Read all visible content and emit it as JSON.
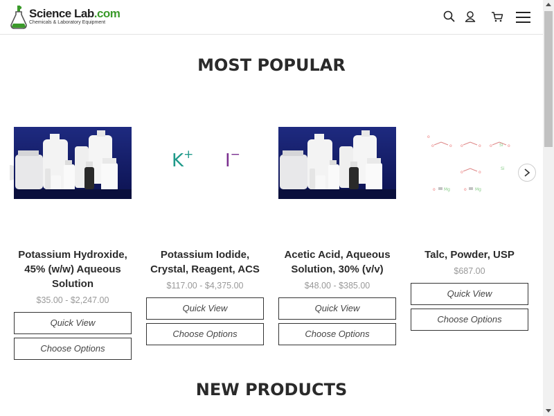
{
  "header": {
    "logo": {
      "main": "Science Lab",
      "dot": ".com",
      "sub": "Chemicals & Laboratory Equipment"
    },
    "icons": [
      "search-icon",
      "account-icon",
      "cart-icon",
      "menu-icon"
    ]
  },
  "sections": {
    "most_popular": "MOST POPULAR",
    "new_products": "NEW PRODUCTS"
  },
  "products": [
    {
      "name_lines": [
        "Potassium Hydroxide,",
        "45% (w/w) Aqueous",
        "Solution"
      ],
      "price": "$35.00 - $2,247.00",
      "quick_view": "Quick View",
      "choose_options": "Choose Options",
      "image": "bottles-photo"
    },
    {
      "name_lines": [
        "Potassium Iodide,",
        "Crystal, Reagent, ACS"
      ],
      "price": "$117.00 - $4,375.00",
      "quick_view": "Quick View",
      "choose_options": "Choose Options",
      "image": "ion-formula",
      "formula": {
        "cation": "K",
        "cation_charge": "+",
        "anion": "I",
        "anion_charge": "−"
      }
    },
    {
      "name_lines": [
        "Acetic Acid, Aqueous",
        "Solution, 30% (v/v)"
      ],
      "price": "$48.00 - $385.00",
      "quick_view": "Quick View",
      "choose_options": "Choose Options",
      "image": "bottles-photo"
    },
    {
      "name_lines": [
        "Talc, Powder, USP"
      ],
      "price": "$687.00",
      "quick_view": "Quick View",
      "choose_options": "Choose Options",
      "image": "structure-diagram"
    }
  ],
  "colors": {
    "potassium": "#1f9a8a",
    "iodide": "#7a2f8f",
    "accent_green": "#3a9a2a"
  }
}
